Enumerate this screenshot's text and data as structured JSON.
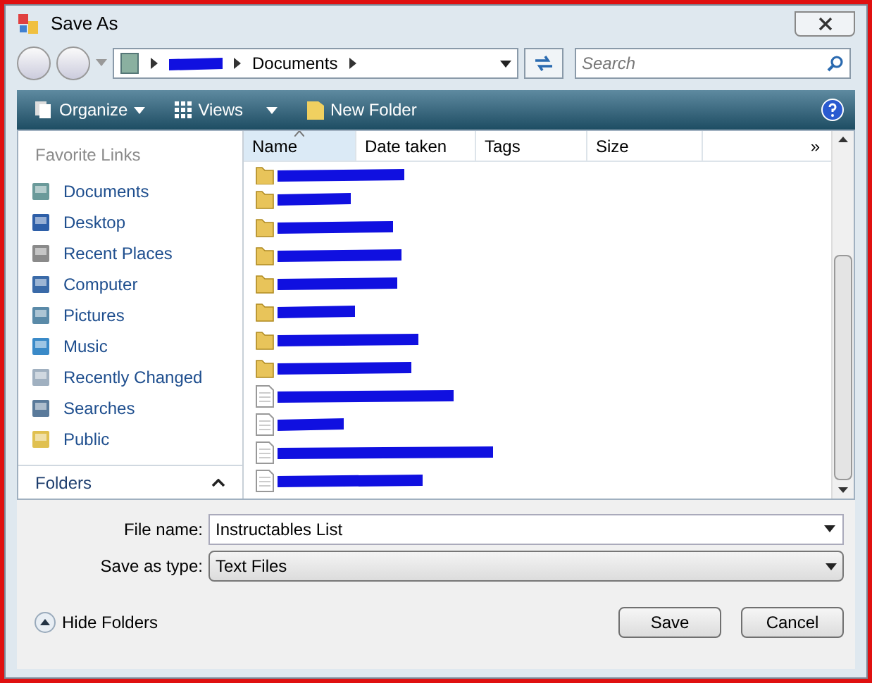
{
  "window": {
    "title": "Save As"
  },
  "address_bar": {
    "segments": [
      {
        "kind": "redacted"
      },
      {
        "kind": "text",
        "label": "Documents"
      }
    ]
  },
  "search": {
    "placeholder": "Search"
  },
  "toolbar": {
    "items": [
      {
        "kind": "organize",
        "label": "Organize"
      },
      {
        "kind": "views",
        "label": "Views"
      },
      {
        "kind": "new-folder",
        "label": "New Folder"
      }
    ]
  },
  "sidebar": {
    "heading": "Favorite Links",
    "items": [
      {
        "kind": "documents",
        "label": "Documents"
      },
      {
        "kind": "desktop",
        "label": "Desktop"
      },
      {
        "kind": "recent",
        "label": "Recent Places"
      },
      {
        "kind": "computer",
        "label": "Computer"
      },
      {
        "kind": "pictures",
        "label": "Pictures"
      },
      {
        "kind": "music",
        "label": "Music"
      },
      {
        "kind": "changed",
        "label": "Recently Changed"
      },
      {
        "kind": "searches",
        "label": "Searches"
      },
      {
        "kind": "public",
        "label": "Public"
      }
    ],
    "folders_label": "Folders"
  },
  "table": {
    "columns": [
      {
        "label": "Name",
        "sorted": true
      },
      {
        "label": "Date taken",
        "sorted": false
      },
      {
        "label": "Tags",
        "sorted": false
      },
      {
        "label": "Size",
        "sorted": false
      }
    ],
    "more": "»",
    "rows": [
      {
        "kind": "folder"
      },
      {
        "kind": "folder"
      },
      {
        "kind": "folder"
      },
      {
        "kind": "folder"
      },
      {
        "kind": "folder"
      },
      {
        "kind": "folder"
      },
      {
        "kind": "folder"
      },
      {
        "kind": "folder"
      },
      {
        "kind": "file"
      },
      {
        "kind": "file"
      },
      {
        "kind": "file"
      },
      {
        "kind": "file"
      }
    ]
  },
  "file_name": {
    "label": "File name:",
    "value": "Instructables List"
  },
  "save_type": {
    "label": "Save as type:",
    "value": "Text Files"
  },
  "hide_folders": "Hide Folders",
  "buttons": [
    "Save",
    "Cancel"
  ]
}
